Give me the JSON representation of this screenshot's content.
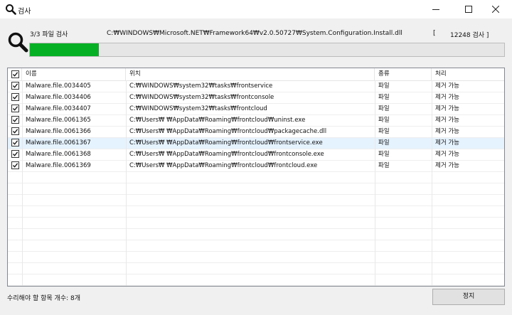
{
  "window": {
    "title": "검사"
  },
  "scan": {
    "progress_label": "3/3 파일 검사",
    "current_path": "C:₩WINDOWS₩Microsoft.NET₩Framework64₩v2.0.50727₩System.Configuration.Install.dll",
    "bracket_open": "[",
    "count_label": "12248 검사 ]",
    "progress_fraction": 0.146
  },
  "table": {
    "columns": [
      "이름",
      "위치",
      "종류",
      "처리"
    ],
    "rows": [
      {
        "name": "Malware.file.0034405",
        "location": "C:₩WINDOWS₩system32₩tasks₩frontservice",
        "type": "파일",
        "action": "제거 가능",
        "checked": true
      },
      {
        "name": "Malware.file.0034406",
        "location": "C:₩WINDOWS₩system32₩tasks₩frontconsole",
        "type": "파일",
        "action": "제거 가능",
        "checked": true
      },
      {
        "name": "Malware.file.0034407",
        "location": "C:₩WINDOWS₩system32₩tasks₩frontcloud",
        "type": "파일",
        "action": "제거 가능",
        "checked": true
      },
      {
        "name": "Malware.file.0061365",
        "location": "C:₩Users₩          ₩AppData₩Roaming₩frontcloud₩uninst.exe",
        "type": "파일",
        "action": "제거 가능",
        "checked": true
      },
      {
        "name": "Malware.file.0061366",
        "location": "C:₩Users₩          ₩AppData₩Roaming₩frontcloud₩packagecache.dll",
        "type": "파일",
        "action": "제거 가능",
        "checked": true
      },
      {
        "name": "Malware.file.0061367",
        "location": "C:₩Users₩          ₩AppData₩Roaming₩frontcloud₩frontservice.exe",
        "type": "파일",
        "action": "제거 가능",
        "checked": true,
        "selected": true
      },
      {
        "name": "Malware.file.0061368",
        "location": "C:₩Users₩          ₩AppData₩Roaming₩frontcloud₩frontconsole.exe",
        "type": "파일",
        "action": "제거 가능",
        "checked": true
      },
      {
        "name": "Malware.file.0061369",
        "location": "C:₩Users₩          ₩AppData₩Roaming₩frontcloud₩frontcloud.exe",
        "type": "파일",
        "action": "제거 가능",
        "checked": true
      }
    ]
  },
  "footer": {
    "repair_count": "수리해야 할 항목 개수: 8개",
    "stop_label": "정지"
  },
  "icons": {
    "app": "search-icon",
    "minimize": "minimize-icon",
    "maximize": "maximize-icon",
    "close": "close-icon"
  },
  "colors": {
    "progress": "#06b025",
    "selected_row": "#e5f3ff"
  }
}
